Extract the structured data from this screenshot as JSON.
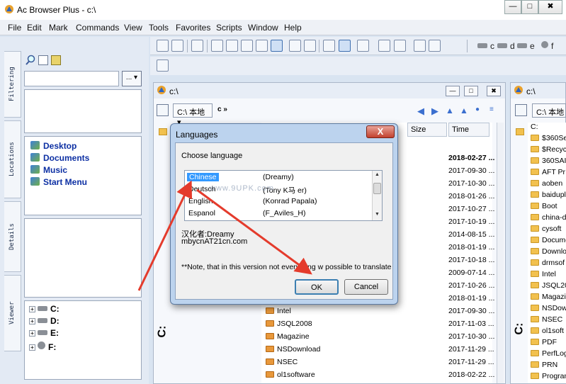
{
  "window": {
    "title": "Ac Browser Plus - c:\\",
    "minimize": "—",
    "maximize": "□",
    "close": "✖"
  },
  "menu": [
    "File",
    "Edit",
    "Mark",
    "Commands",
    "View",
    "Tools",
    "Favorites",
    "Scripts",
    "Window",
    "Help"
  ],
  "drives_toolbar": [
    "c",
    "d",
    "e",
    "f"
  ],
  "side_tabs": [
    "Filtering",
    "Locations",
    "Details",
    "Viewer"
  ],
  "filter": {
    "menu_button": "..."
  },
  "locations": [
    "Desktop",
    "Documents",
    "Music",
    "Start Menu"
  ],
  "drive_tree": [
    "C:",
    "D:",
    "E:",
    "F:"
  ],
  "center_panel": {
    "title": "c:\\",
    "path": "C:\\ 本地",
    "vertical_label": "C:",
    "columns": [
      "Size",
      "Time"
    ],
    "folders": [
      "Intel",
      "JSQL2008",
      "Magazine",
      "NSDownload",
      "NSEC",
      "ol1software"
    ],
    "times": [
      "2018-02-27 ...",
      "2017-09-30 ...",
      "2017-10-30 ...",
      "2018-01-26 ...",
      "2017-10-27 ...",
      "2017-10-19 ...",
      "2014-08-15 ...",
      "2018-01-19 ...",
      "2017-10-18 ...",
      "2009-07-14 ...",
      "2017-10-26 ...",
      "2018-01-19 ...",
      "2017-09-30 ...",
      "2017-11-03 ...",
      "2017-10-30 ...",
      "2017-11-29 ...",
      "2017-11-29 ...",
      "2018-02-22 ..."
    ]
  },
  "right_panel": {
    "title": "c:\\",
    "path": "C:\\ 本地",
    "vertical_label": "C:",
    "root": "C:",
    "folders": [
      "$360Se",
      "$Recyc",
      "360SAI",
      "AFT Pr",
      "aoben",
      "baidupl",
      "Boot",
      "china-d",
      "cysoft",
      "Docume",
      "Downlo",
      "drmsof",
      "Intel",
      "JSQL20",
      "Magazi",
      "NSDow",
      "NSEC",
      "ol1soft",
      "PDF",
      "PerfLog",
      "PRN",
      "Program"
    ]
  },
  "dialog": {
    "title": "Languages",
    "close": "X",
    "prompt": "Choose language",
    "languages": [
      {
        "name": "Chinese",
        "author": "(Dreamy)"
      },
      {
        "name": "Deutsch",
        "author": "(Tony K马 er)"
      },
      {
        "name": "English",
        "author": "(Konrad Papala)"
      },
      {
        "name": "Espanol",
        "author": "(F_Aviles_H)"
      }
    ],
    "translator_line": "汉化者:Dreamy",
    "email_line": "mbycnAT21cn.com",
    "note": "**Note, that in this version not everything w  possible to translate",
    "ok": "OK",
    "cancel": "Cancel"
  },
  "watermark": "www.9UPK.com"
}
